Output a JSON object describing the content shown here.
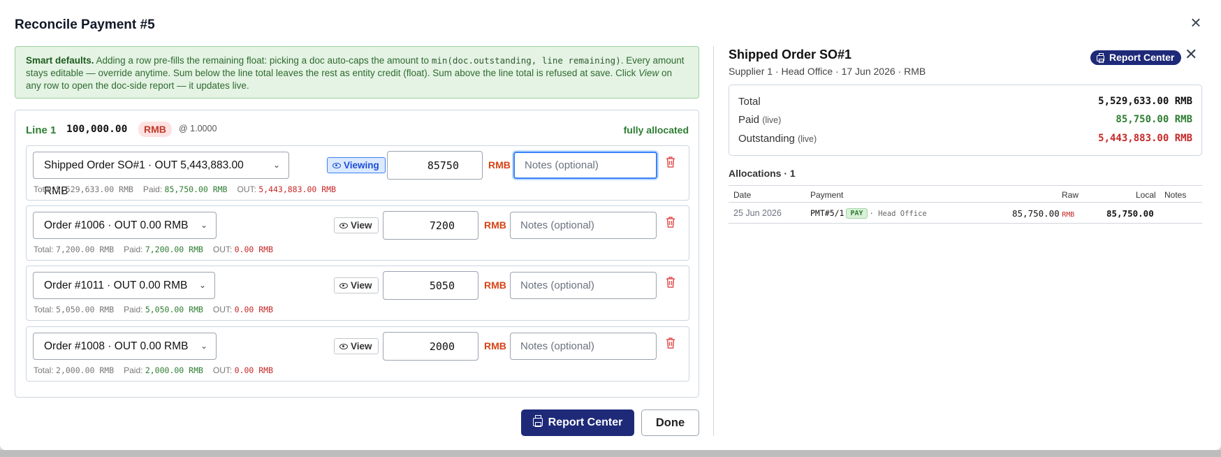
{
  "modal": {
    "title": "Reconcile Payment #5",
    "close_icon": "×"
  },
  "hint": {
    "bold": "Smart defaults.",
    "part1": " Adding a row pre-fills the remaining float: picking a doc auto-caps the amount to ",
    "code": "min(doc.outstanding, line remaining)",
    "part2": ". Every amount stays editable — override anytime. Sum below the line total leaves the rest as entity credit (float). Sum above the line total is refused at save. Click ",
    "italic": "View",
    "part3": " on any row to open the doc-side report — it updates live."
  },
  "line": {
    "label": "Line 1",
    "amount": "100,000.00",
    "currency": "RMB",
    "rate": "@ 1.0000",
    "status": "fully allocated"
  },
  "rows": [
    {
      "doc_label": "Shipped Order SO#1 · OUT 5,443,883.00 RMB",
      "view_label": "Viewing",
      "amount": "85750",
      "currency": "RMB",
      "notes_placeholder": "Notes (optional)",
      "total_label": "Total:",
      "total": "5,529,633.00 RMB",
      "paid_label": "Paid:",
      "paid": "85,750.00 RMB",
      "out_label": "OUT:",
      "out": "5,443,883.00 RMB"
    },
    {
      "doc_label": "Order #1006 · OUT 0.00 RMB",
      "view_label": "View",
      "amount": "7200",
      "currency": "RMB",
      "notes_placeholder": "Notes (optional)",
      "total_label": "Total:",
      "total": "7,200.00 RMB",
      "paid_label": "Paid:",
      "paid": "7,200.00 RMB",
      "out_label": "OUT:",
      "out": "0.00 RMB"
    },
    {
      "doc_label": "Order #1011 · OUT 0.00 RMB",
      "view_label": "View",
      "amount": "5050",
      "currency": "RMB",
      "notes_placeholder": "Notes (optional)",
      "total_label": "Total:",
      "total": "5,050.00 RMB",
      "paid_label": "Paid:",
      "paid": "5,050.00 RMB",
      "out_label": "OUT:",
      "out": "0.00 RMB"
    },
    {
      "doc_label": "Order #1008 · OUT 0.00 RMB",
      "view_label": "View",
      "amount": "2000",
      "currency": "RMB",
      "notes_placeholder": "Notes (optional)",
      "total_label": "Total:",
      "total": "2,000.00 RMB",
      "paid_label": "Paid:",
      "paid": "2,000.00 RMB",
      "out_label": "OUT:",
      "out": "0.00 RMB"
    }
  ],
  "footer": {
    "report_label": "Report Center",
    "done_label": "Done"
  },
  "doc_panel": {
    "title": "Shipped Order SO#1",
    "subtitle": "Supplier 1 · Head Office · 17 Jun 2026 · RMB",
    "report_label": "Report Center",
    "close_icon": "✕",
    "summary": {
      "total_label": "Total",
      "total": "5,529,633.00 RMB",
      "paid_label": "Paid",
      "paid_note": "(live)",
      "paid": "85,750.00 RMB",
      "outstanding_label": "Outstanding",
      "outstanding_note": "(live)",
      "outstanding": "5,443,883.00 RMB"
    },
    "allocations_title": "Allocations · 1",
    "columns": [
      "Date",
      "Payment",
      "Raw",
      "Local",
      "Notes"
    ],
    "allocations": [
      {
        "date": "25 Jun 2026",
        "payment": "PMT#5/1",
        "badge": "PAY",
        "office": "· Head Office",
        "raw": "85,750.00",
        "raw_ccy": "RMB",
        "local": "85,750.00",
        "notes": ""
      }
    ]
  },
  "colors": {
    "accent_navy": "#1e2a78",
    "green": "#2e7d32",
    "red": "#c62828",
    "currency_orange": "#d84315",
    "hint_bg": "#e4f3e4"
  },
  "icons": {
    "eye": "eye-icon",
    "trash": "trash-icon",
    "printer": "printer-icon",
    "close": "close-icon",
    "chevron": "chevron-down-icon"
  }
}
